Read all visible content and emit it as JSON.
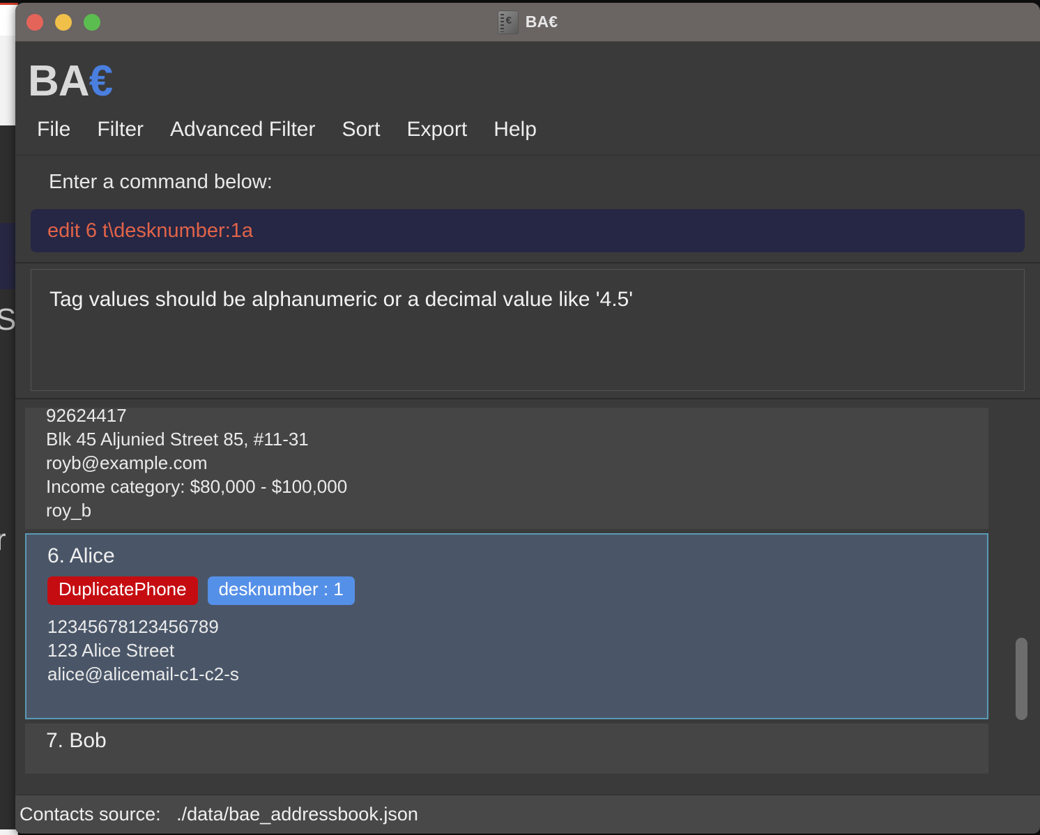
{
  "window": {
    "title": "BA€",
    "icon": "address-book-icon",
    "controls": {
      "close": "close",
      "minimize": "minimize",
      "maximize": "maximize"
    }
  },
  "logo": {
    "primary": "BA",
    "accent": "€",
    "primary_color": "#d9d9d9",
    "accent_color": "#4a7fe0"
  },
  "menu": {
    "items": [
      {
        "label": "File"
      },
      {
        "label": "Filter"
      },
      {
        "label": "Advanced Filter"
      },
      {
        "label": "Sort"
      },
      {
        "label": "Export"
      },
      {
        "label": "Help"
      }
    ]
  },
  "command": {
    "label": "Enter a command below:",
    "value": "edit 6 t\\desknumber:1a",
    "placeholder": "Enter a command below:",
    "text_color": "#e06449",
    "background_color": "#262645"
  },
  "result": {
    "message": "Tag values should be alphanumeric or a decimal value like '4.5'"
  },
  "contacts": {
    "partial_top": {
      "lines": [
        "92624417",
        "Blk 45 Aljunied Street 85, #11-31",
        "royb@example.com",
        "Income category: $80,000 - $100,000",
        "roy_b"
      ]
    },
    "selected": {
      "title": "6. Alice",
      "tags": [
        {
          "label": "DuplicatePhone",
          "kind": "danger",
          "color": "#c50d11"
        },
        {
          "label": "desknumber : 1",
          "kind": "info",
          "color": "#5590e8"
        }
      ],
      "lines": [
        "12345678123456789",
        "123 Alice Street",
        "alice@alicemail-c1-c2-s"
      ],
      "border_color": "#5a9ab5",
      "background_color": "#4a5668"
    },
    "next": {
      "title": "7. Bob"
    }
  },
  "status": {
    "text": "Contacts source:   ./data/bae_addressbook.json"
  },
  "background_fragments": {
    "frag_one": "S",
    "frag_two": "r"
  }
}
